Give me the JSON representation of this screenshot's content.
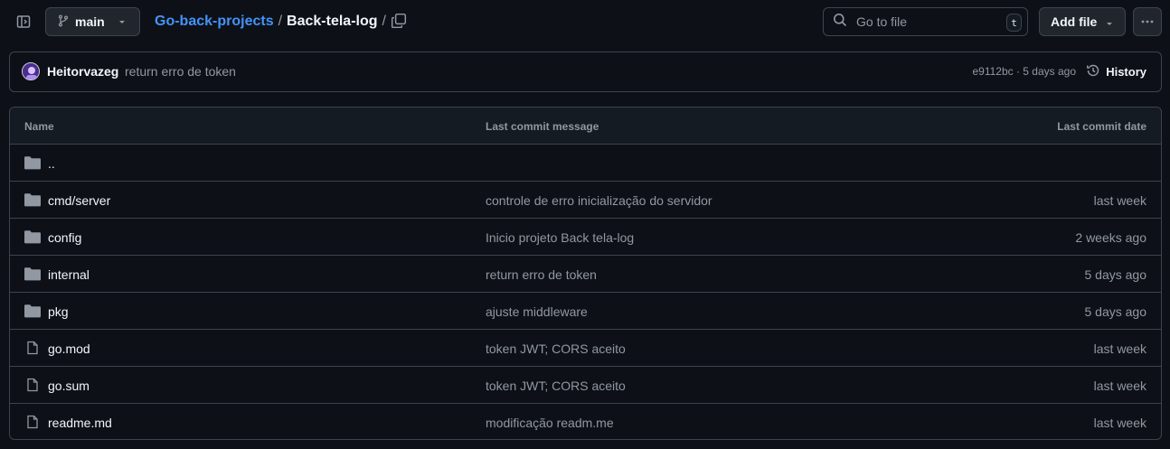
{
  "topbar": {
    "branch": "main",
    "breadcrumb": {
      "repo": "Go-back-projects",
      "sep1": "/",
      "current": "Back-tela-log",
      "sep2": "/"
    },
    "goto": {
      "placeholder": "Go to file",
      "shortcut": "t"
    },
    "add_file_label": "Add file"
  },
  "commit": {
    "author": "Heitorvazeg",
    "message": "return erro de token",
    "meta": "e9112bc · 5 days ago",
    "history_label": "History"
  },
  "table": {
    "headers": {
      "name": "Name",
      "message": "Last commit message",
      "date": "Last commit date"
    },
    "rows": [
      {
        "type": "folder",
        "name": "..",
        "message": "",
        "date": ""
      },
      {
        "type": "folder",
        "name": "cmd/server",
        "message": "controle de erro inicialização do servidor",
        "date": "last week"
      },
      {
        "type": "folder",
        "name": "config",
        "message": "Inicio projeto Back tela-log",
        "date": "2 weeks ago"
      },
      {
        "type": "folder",
        "name": "internal",
        "message": "return erro de token",
        "date": "5 days ago"
      },
      {
        "type": "folder",
        "name": "pkg",
        "message": "ajuste middleware",
        "date": "5 days ago"
      },
      {
        "type": "file",
        "name": "go.mod",
        "message": "token JWT; CORS aceito",
        "date": "last week"
      },
      {
        "type": "file",
        "name": "go.sum",
        "message": "token JWT; CORS aceito",
        "date": "last week"
      },
      {
        "type": "file",
        "name": "readme.md",
        "message": "modificação readm.me",
        "date": "last week"
      }
    ]
  },
  "colors": {
    "background": "#0d1117",
    "link": "#4493f8",
    "muted": "#9198a1",
    "border": "#3d444d"
  }
}
